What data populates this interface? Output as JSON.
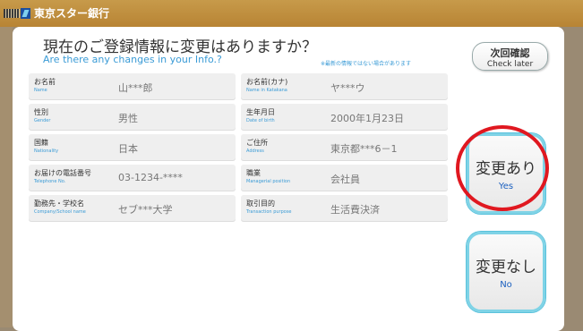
{
  "header": {
    "bank_name": "東京スター銀行"
  },
  "title": {
    "ja": "現在のご登録情報に変更はありますか？",
    "en": "Are there any changes in your Info.?"
  },
  "note": "※最新の情報ではない場合があります",
  "check_later": {
    "ja": "次回確認",
    "en": "Check later"
  },
  "fields": [
    [
      {
        "label_ja": "お名前",
        "label_en": "Name",
        "value": "山***郎"
      },
      {
        "label_ja": "お名前(カナ)",
        "label_en": "Name in Katakana",
        "value": "ヤ***ウ"
      }
    ],
    [
      {
        "label_ja": "性別",
        "label_en": "Gender",
        "value": "男性"
      },
      {
        "label_ja": "生年月日",
        "label_en": "Date of birth",
        "value": "2000年1月23日"
      }
    ],
    [
      {
        "label_ja": "国籍",
        "label_en": "Nationality",
        "value": "日本"
      },
      {
        "label_ja": "ご住所",
        "label_en": "Address",
        "value": "東京都***6－1"
      }
    ],
    [
      {
        "label_ja": "お届けの電話番号",
        "label_en": "Telephone No.",
        "value": "03-1234-****"
      },
      {
        "label_ja": "職業",
        "label_en": "Managerial position",
        "value": "会社員"
      }
    ],
    [
      {
        "label_ja": "勤務先・学校名",
        "label_en": "Company/School name",
        "value": "セブ***大学"
      },
      {
        "label_ja": "取引目的",
        "label_en": "Transaction purpose",
        "value": "生活費決済"
      }
    ]
  ],
  "yes_button": {
    "ja": "変更あり",
    "en": "Yes"
  },
  "no_button": {
    "ja": "変更なし",
    "en": "No"
  },
  "colors": {
    "header": "#b88434",
    "accent_blue": "#3a9bd6",
    "button_border": "#7fd3e6",
    "highlight": "#e01820"
  }
}
